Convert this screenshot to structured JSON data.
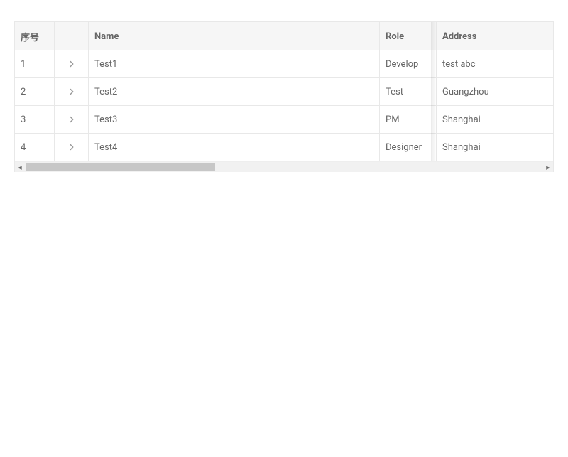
{
  "table": {
    "columns": {
      "index": "序号",
      "expand": "",
      "name": "Name",
      "role": "Role",
      "address": "Address"
    },
    "rows": [
      {
        "index": "1",
        "name": "Test1",
        "role": "Develop",
        "address": "test abc"
      },
      {
        "index": "2",
        "name": "Test2",
        "role": "Test",
        "address": "Guangzhou"
      },
      {
        "index": "3",
        "name": "Test3",
        "role": "PM",
        "address": "Shanghai"
      },
      {
        "index": "4",
        "name": "Test4",
        "role": "Designer",
        "address": "Shanghai"
      }
    ]
  }
}
